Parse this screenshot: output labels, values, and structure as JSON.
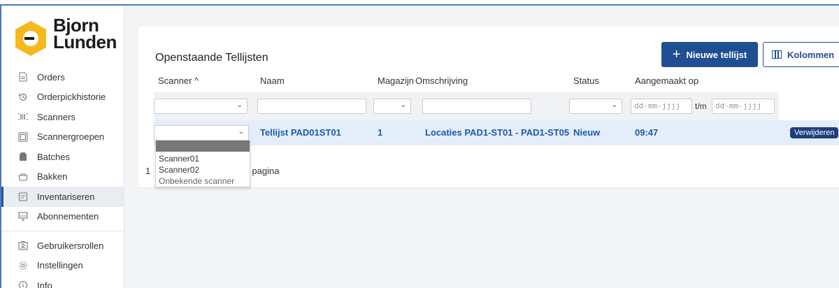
{
  "brand": {
    "line1": "Bjorn",
    "line2": "Lunden",
    "accent": "#f5b91e"
  },
  "sidebar": {
    "items": [
      {
        "label": "Orders",
        "icon": "document-icon"
      },
      {
        "label": "Orderpickhistorie",
        "icon": "history-icon"
      },
      {
        "label": "Scanners",
        "icon": "barcode-icon"
      },
      {
        "label": "Scannergroepen",
        "icon": "scanner-group-icon"
      },
      {
        "label": "Batches",
        "icon": "batch-icon"
      },
      {
        "label": "Bakken",
        "icon": "bin-icon"
      },
      {
        "label": "Inventariseren",
        "icon": "clipboard-icon",
        "active": true
      },
      {
        "label": "Abonnementen",
        "icon": "monitor-icon"
      },
      {
        "label": "Gebruikersrollen",
        "icon": "user-roles-icon"
      },
      {
        "label": "Instellingen",
        "icon": "gear-icon"
      },
      {
        "label": "Info",
        "icon": "info-icon"
      }
    ]
  },
  "card": {
    "title": "Openstaande Tellijsten",
    "new_button": "Nieuwe tellijst",
    "columns_button": "Kolommen"
  },
  "table": {
    "headers": {
      "scanner": "Scanner ^",
      "naam": "Naam",
      "magazijn": "Magazijn",
      "omschrijving": "Omschrijving",
      "status": "Status",
      "aangemaakt": "Aangemaakt op"
    },
    "filters": {
      "date_from_placeholder": "dd-mm-jjjj",
      "date_sep": "t/m",
      "date_to_placeholder": "dd-mm-jjjj"
    },
    "rows": [
      {
        "naam": "Tellijst PAD01ST01",
        "magazijn": "1",
        "omschrijving": "Locaties PAD1-ST01 - PAD1-ST05",
        "status": "Nieuw",
        "aangemaakt": "09:47",
        "action": "Verwijderen"
      }
    ],
    "footer_prefix": "1",
    "footer_suffix": "per pagina"
  },
  "scanner_dropdown": {
    "options": [
      "Scanner01",
      "Scanner02",
      "Onbekende scanner"
    ]
  },
  "colors": {
    "primary": "#1f4e93",
    "row_highlight": "#e4eefb",
    "danger_badge": "#1f3f78"
  }
}
